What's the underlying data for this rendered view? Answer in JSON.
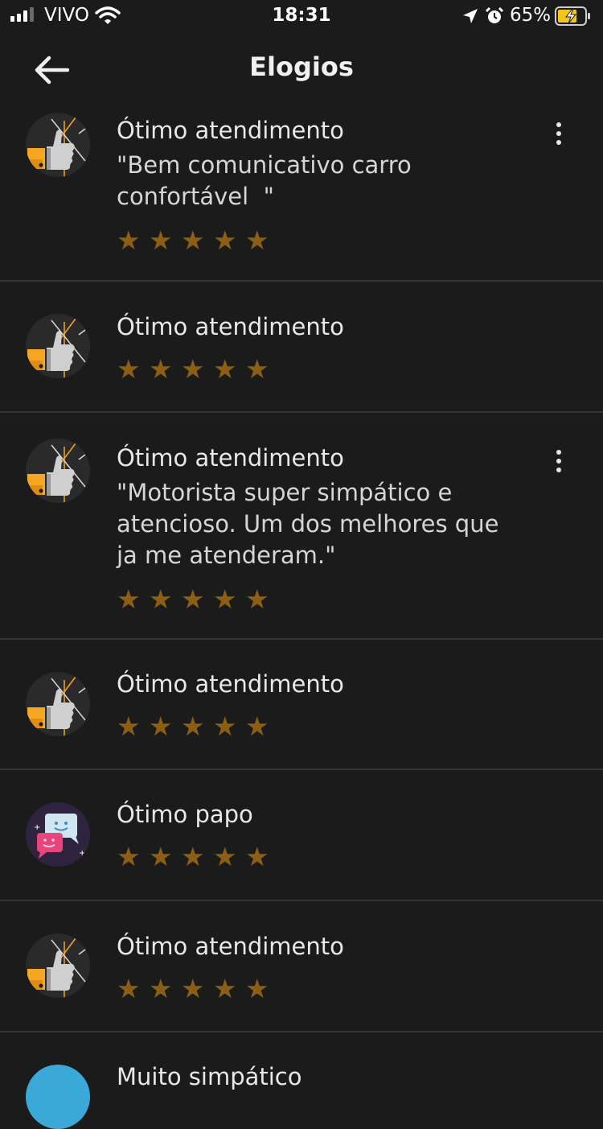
{
  "status_bar": {
    "carrier": "VIVO",
    "time": "18:31",
    "battery": "65%"
  },
  "header": {
    "title": "Elogios"
  },
  "colors": {
    "background": "#1b1b1b",
    "star": "#8b5e14",
    "divider": "#333333",
    "thumb_yellow": "#f5a623",
    "chat_purple": "#2e2440"
  },
  "compliments": [
    {
      "icon": "thumbs-up-icon",
      "title": "Ótimo atendimento",
      "comment": "\"Bem comunicativo carro\nconfortável  \"",
      "rating": 5,
      "has_menu": true
    },
    {
      "icon": "thumbs-up-icon",
      "title": "Ótimo atendimento",
      "comment": "",
      "rating": 5,
      "has_menu": false
    },
    {
      "icon": "thumbs-up-icon",
      "title": "Ótimo atendimento",
      "comment": "\"Motorista super simpático e\natencioso. Um dos melhores que\nja me atenderam.\"",
      "rating": 5,
      "has_menu": true
    },
    {
      "icon": "thumbs-up-icon",
      "title": "Ótimo atendimento",
      "comment": "",
      "rating": 5,
      "has_menu": false
    },
    {
      "icon": "chat-bubbles-icon",
      "title": "Ótimo papo",
      "comment": "",
      "rating": 5,
      "has_menu": false
    },
    {
      "icon": "thumbs-up-icon",
      "title": "Ótimo atendimento",
      "comment": "",
      "rating": 5,
      "has_menu": false
    }
  ],
  "partial_item": {
    "title": "Muito simpático"
  }
}
